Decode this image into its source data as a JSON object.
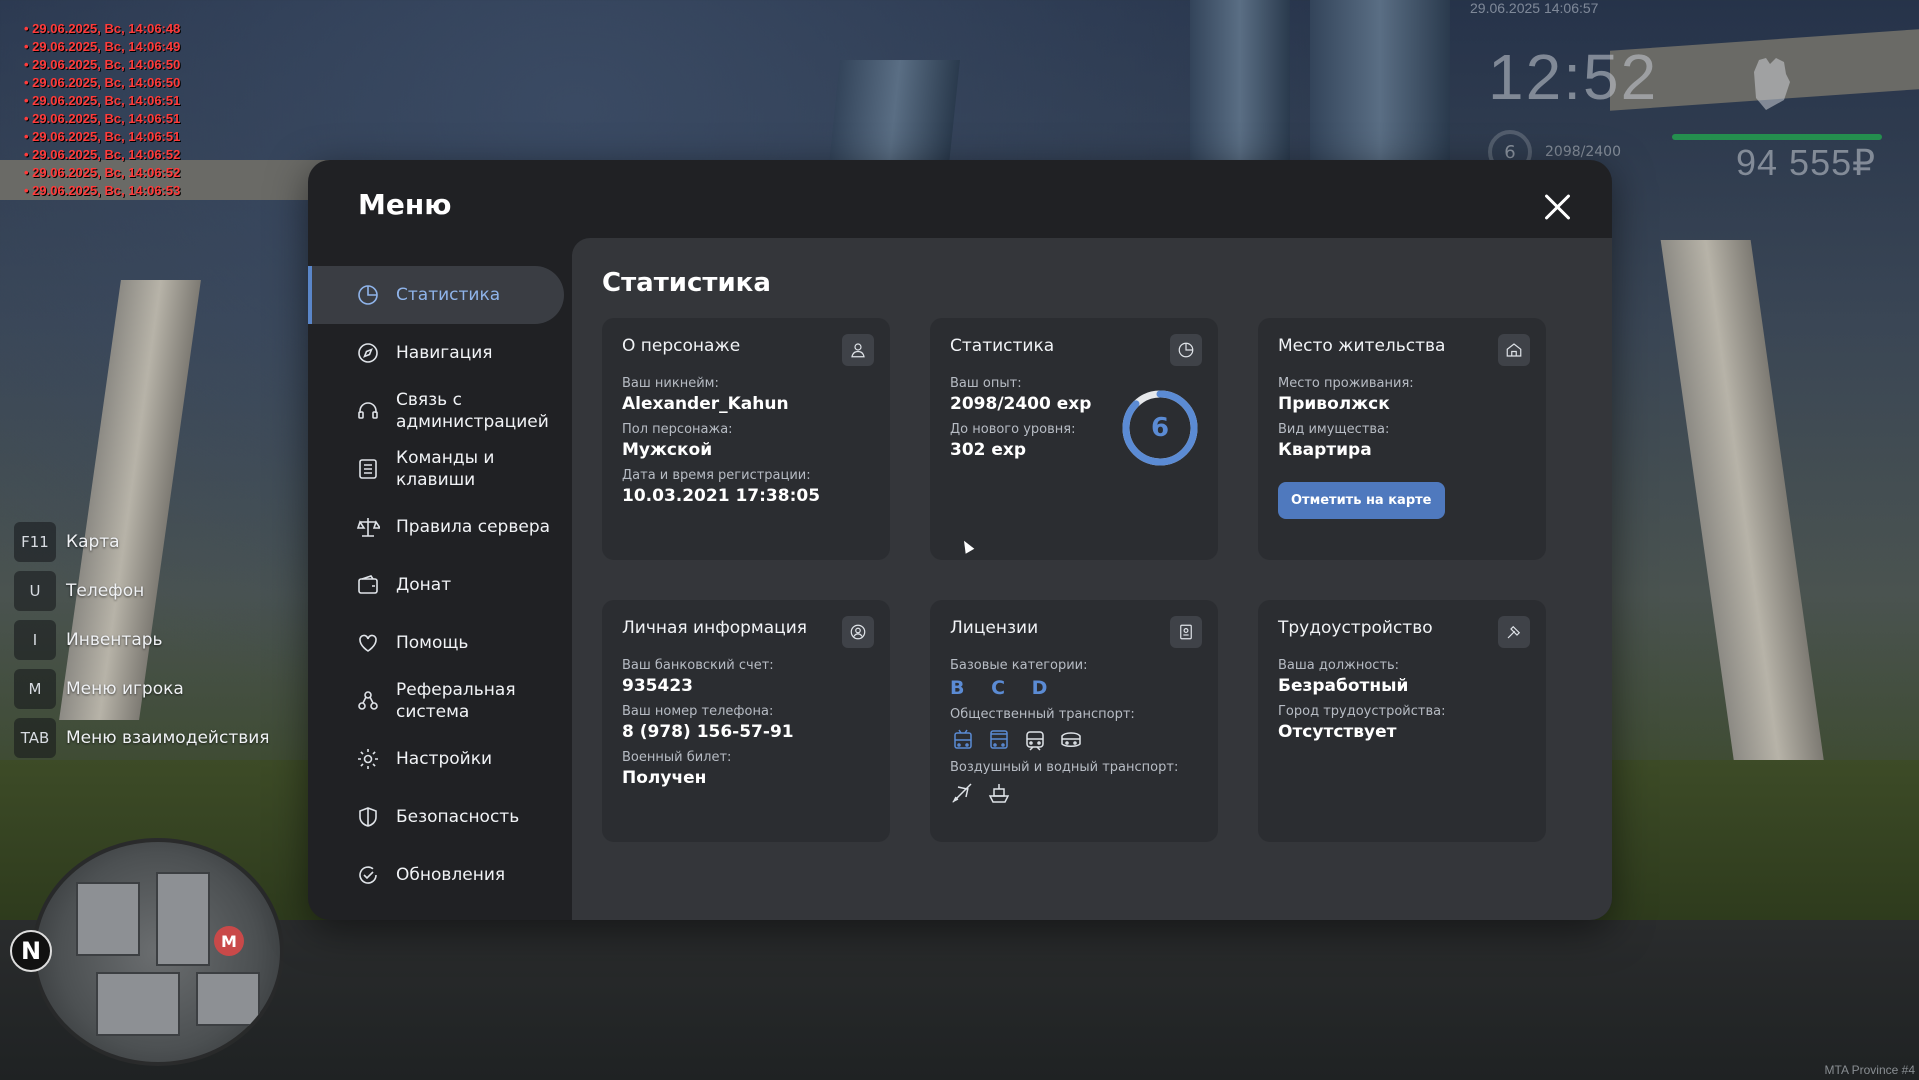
{
  "chat_log": [
    "29.06.2025, Вс, 14:06:48",
    "29.06.2025, Вс, 14:06:49",
    "29.06.2025, Вс, 14:06:50",
    "29.06.2025, Вс, 14:06:50",
    "29.06.2025, Вс, 14:06:51",
    "29.06.2025, Вс, 14:06:51",
    "29.06.2025, Вс, 14:06:51",
    "29.06.2025, Вс, 14:06:52",
    "29.06.2025, Вс, 14:06:52",
    "29.06.2025, Вс, 14:06:53"
  ],
  "hud": {
    "date": "29.06.2025 14:06:57",
    "time": "12:52",
    "level": "6",
    "exp": "2098/2400",
    "money": "94 555₽",
    "fist_icon": "fist-icon"
  },
  "hotkeys": [
    {
      "key": "F11",
      "label": "Карта"
    },
    {
      "key": "U",
      "label": "Телефон"
    },
    {
      "key": "I",
      "label": "Инвентарь"
    },
    {
      "key": "M",
      "label": "Меню игрока"
    },
    {
      "key": "TAB",
      "label": "Меню взаимодействия"
    }
  ],
  "minimap": {
    "compass": "N",
    "metro": "M"
  },
  "watermark": "MTA Province #4",
  "menu": {
    "title": "Меню",
    "sidebar": [
      {
        "label": "Статистика",
        "icon": "chart-pie-icon",
        "active": true
      },
      {
        "label": "Навигация",
        "icon": "compass-icon"
      },
      {
        "label": "Связь с администрацией",
        "icon": "headset-icon"
      },
      {
        "label": "Команды и клавиши",
        "icon": "list-icon"
      },
      {
        "label": "Правила сервера",
        "icon": "scales-icon"
      },
      {
        "label": "Донат",
        "icon": "wallet-icon"
      },
      {
        "label": "Помощь",
        "icon": "heart-hand-icon"
      },
      {
        "label": "Реферальная система",
        "icon": "referral-icon"
      },
      {
        "label": "Настройки",
        "icon": "gear-icon"
      },
      {
        "label": "Безопасность",
        "icon": "shield-icon"
      },
      {
        "label": "Обновления",
        "icon": "refresh-check-icon"
      }
    ],
    "section_title": "Статистика",
    "cards": {
      "character": {
        "title": "О персонаже",
        "icon": "user-icon",
        "nickname_label": "Ваш никнейм:",
        "nickname": "Alexander_Kahun",
        "gender_label": "Пол персонажа:",
        "gender": "Мужской",
        "reg_label": "Дата и время регистрации:",
        "reg": "10.03.2021 17:38:05"
      },
      "stats": {
        "title": "Статистика",
        "icon": "chart-pie-icon",
        "exp_label": "Ваш опыт:",
        "exp": "2098/2400 exp",
        "next_label": "До нового уровня:",
        "next": "302 exp",
        "level": "6",
        "progress": 0.874
      },
      "residence": {
        "title": "Место жительства",
        "icon": "house-icon",
        "place_label": "Место проживания:",
        "place": "Приволжск",
        "type_label": "Вид имущества:",
        "type": "Квартира",
        "button": "Отметить на карте"
      },
      "personal": {
        "title": "Личная информация",
        "icon": "user-circle-icon",
        "bank_label": "Ваш банковский счет:",
        "bank": "935423",
        "phone_label": "Ваш номер телефона:",
        "phone": "8 (978) 156-57-91",
        "military_label": "Военный билет:",
        "military": "Получен"
      },
      "licenses": {
        "title": "Лицензии",
        "icon": "license-icon",
        "base_label": "Базовые категории:",
        "base": "B C D",
        "public_label": "Общественный транспорт:",
        "air_label": "Воздушный и водный транспорт:"
      },
      "employment": {
        "title": "Трудоустройство",
        "icon": "hammer-icon",
        "position_label": "Ваша должность:",
        "position": "Безработный",
        "city_label": "Город трудоустройства:",
        "city": "Отсутствует"
      }
    }
  },
  "colors": {
    "accent": "#5b8bd4",
    "button": "#4f79be",
    "panel": "#202124",
    "content": "#34363a",
    "card": "#2b2d31"
  }
}
